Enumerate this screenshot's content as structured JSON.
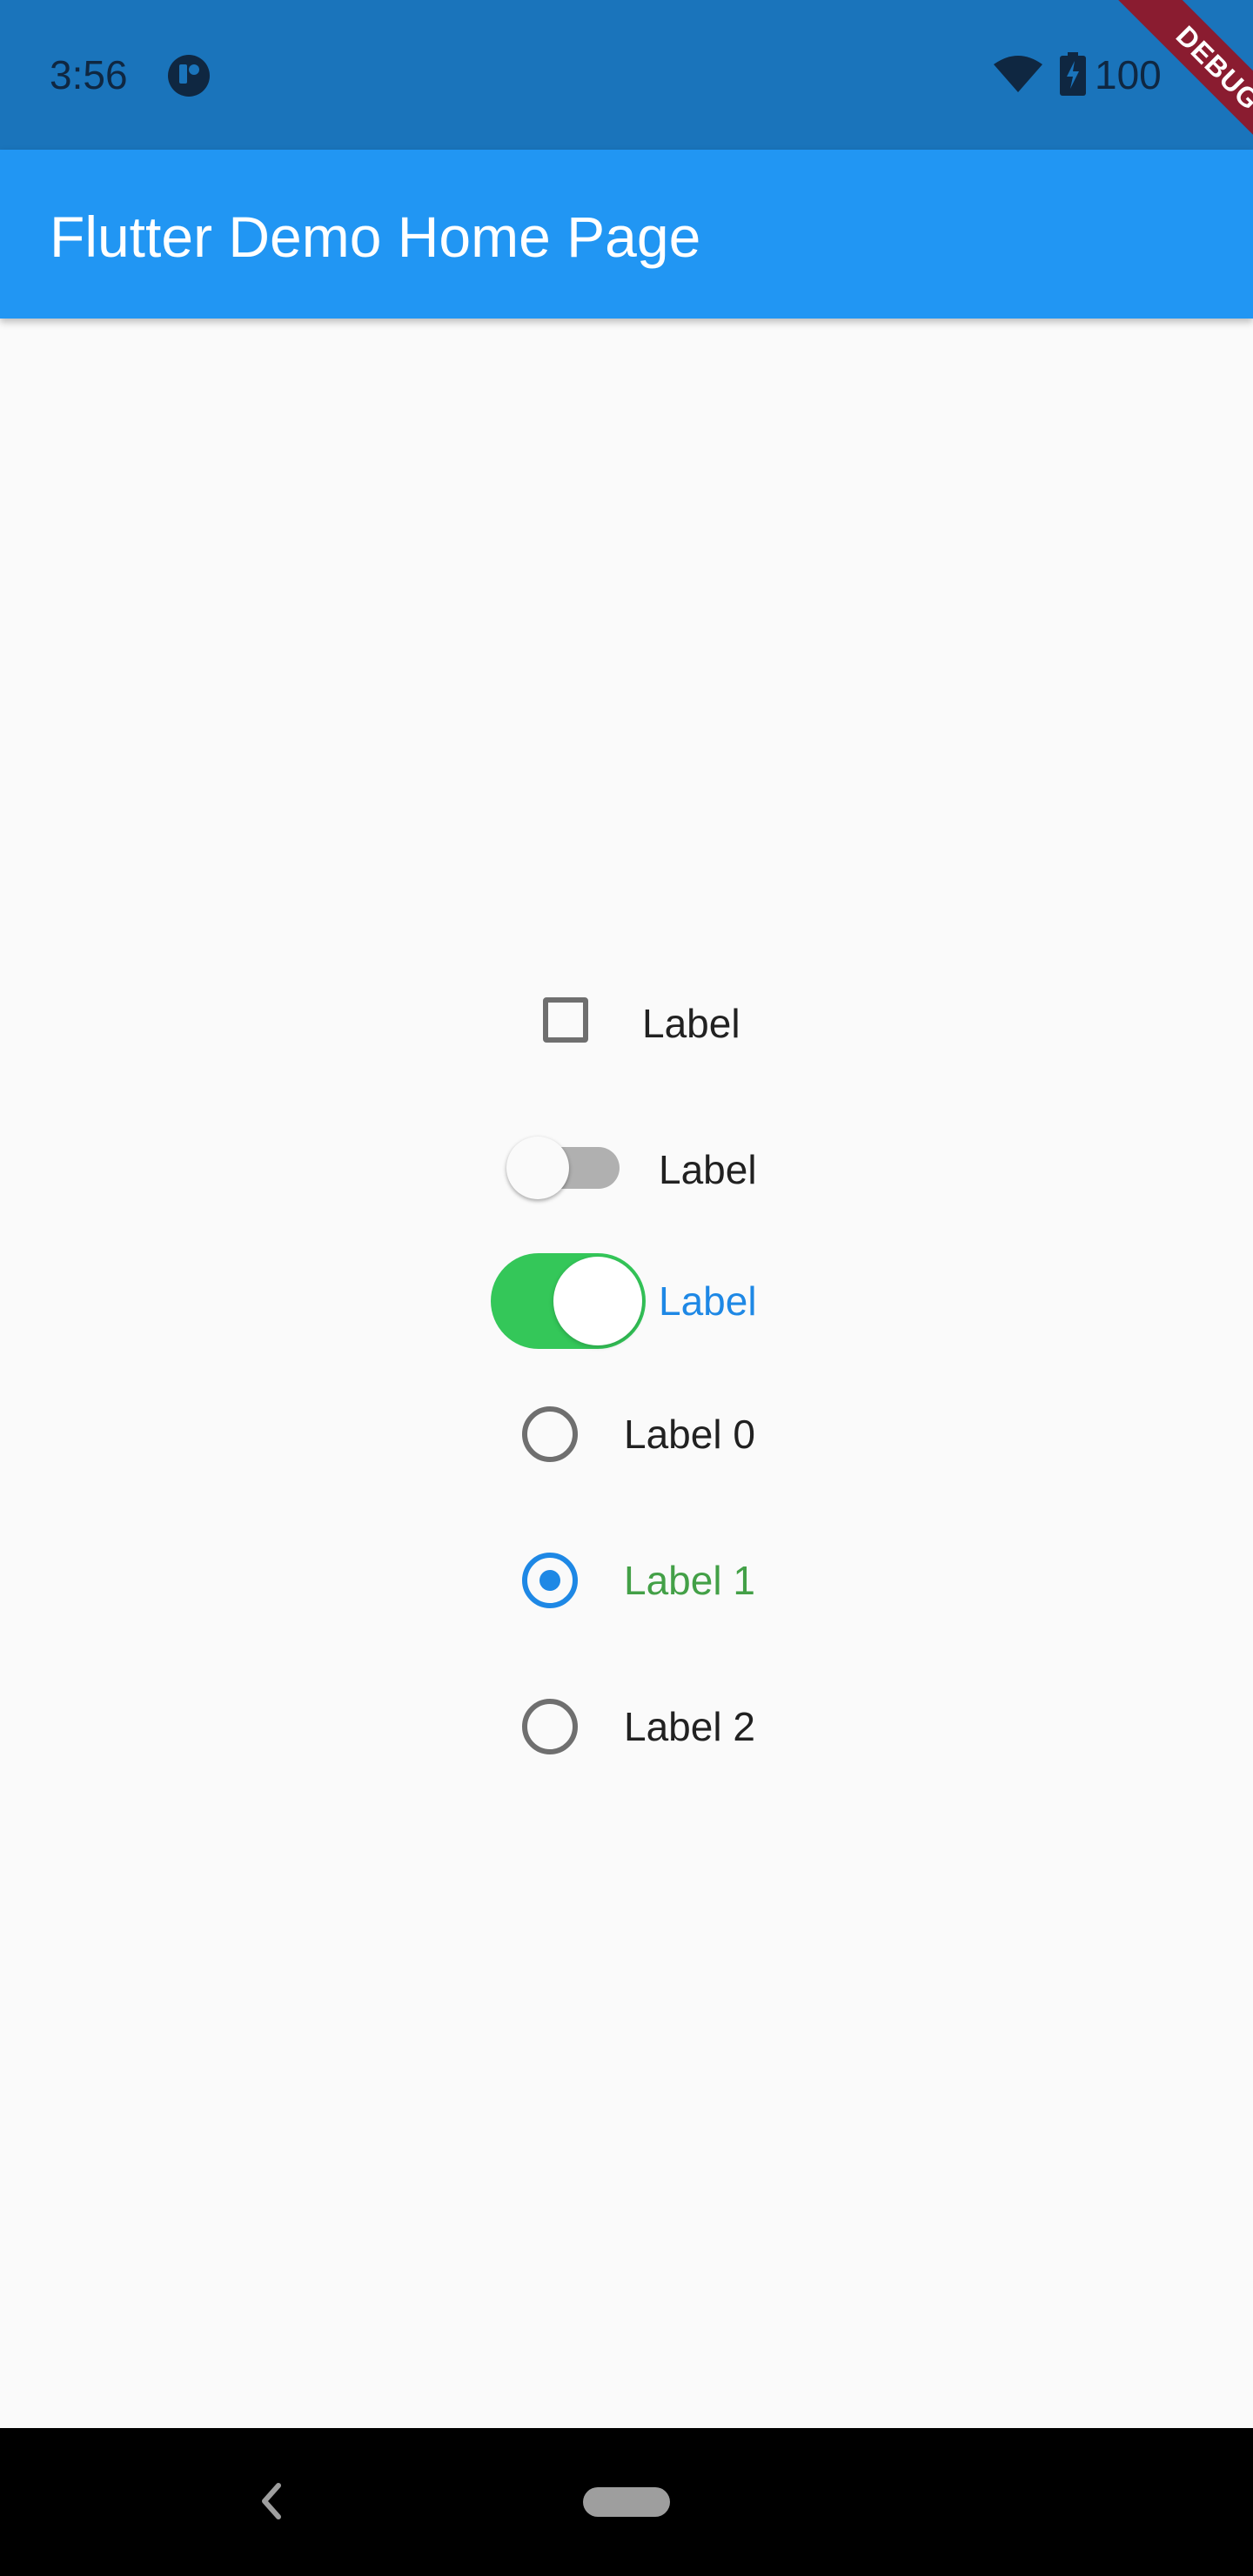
{
  "status_bar": {
    "time": "3:56",
    "battery_text": "100",
    "icons": [
      "app-notification-icon",
      "wifi-icon",
      "battery-charging-icon"
    ]
  },
  "debug_banner": {
    "text": "DEBUG"
  },
  "app_bar": {
    "title": "Flutter Demo Home Page",
    "color": "#2196f3"
  },
  "controls": {
    "checkbox": {
      "label": "Label",
      "checked": false
    },
    "material_switch": {
      "label": "Label",
      "on": false
    },
    "cupertino_switch": {
      "label": "Label",
      "on": true,
      "color": "#34c759"
    },
    "radios": [
      {
        "label": "Label 0",
        "selected": false
      },
      {
        "label": "Label 1",
        "selected": true
      },
      {
        "label": "Label 2",
        "selected": false
      }
    ]
  },
  "nav_bar": {
    "icons": [
      "back-icon",
      "home-pill-icon"
    ]
  },
  "colors": {
    "status_bar": "#1a74bb",
    "accent_blue": "#1e88e5",
    "selected_label_green": "#43a047",
    "background": "#fafafa"
  }
}
